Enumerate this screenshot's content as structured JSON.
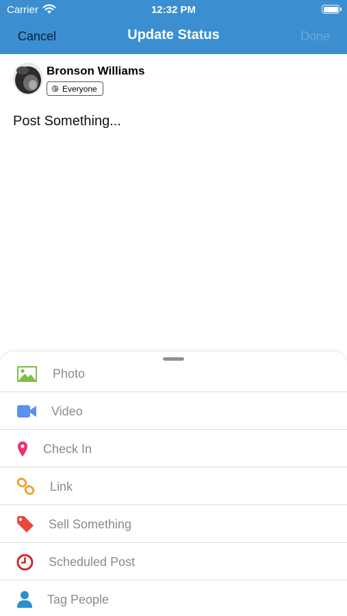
{
  "status_bar": {
    "carrier": "Carrier",
    "time": "12:32 PM"
  },
  "nav": {
    "cancel_label": "Cancel",
    "title": "Update Status",
    "done_label": "Done"
  },
  "post": {
    "user_name": "Bronson Williams",
    "audience": "Everyone",
    "placeholder": "Post Something..."
  },
  "colors": {
    "nav_bar": "#3b8fd0",
    "photo": "#7cbf46",
    "video": "#5b8ff0",
    "check_in": "#e8336d",
    "link": "#f0a22e",
    "sell": "#e8473d",
    "scheduled": "#d32424",
    "tag_people": "#2e8fd0"
  },
  "options": [
    {
      "label": "Photo",
      "icon": "photo-icon"
    },
    {
      "label": "Video",
      "icon": "video-icon"
    },
    {
      "label": "Check In",
      "icon": "location-pin-icon"
    },
    {
      "label": "Link",
      "icon": "link-icon"
    },
    {
      "label": "Sell Something",
      "icon": "tag-icon"
    },
    {
      "label": "Scheduled Post",
      "icon": "clock-icon"
    },
    {
      "label": "Tag People",
      "icon": "person-icon"
    }
  ]
}
